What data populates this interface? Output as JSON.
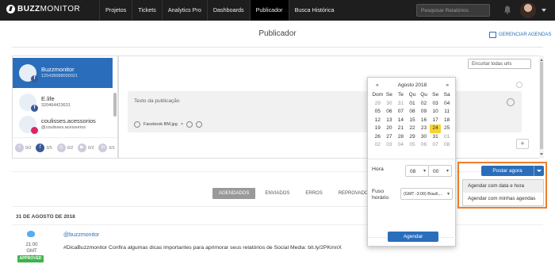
{
  "brand": {
    "name_bold": "BUZZ",
    "name_light": "MONITOR"
  },
  "nav": [
    {
      "label": "Projetos"
    },
    {
      "label": "Tickets"
    },
    {
      "label": "Analytics Pro"
    },
    {
      "label": "Dashboards"
    },
    {
      "label": "Publicador",
      "active": true
    },
    {
      "label": "Busca Histórica"
    }
  ],
  "search": {
    "placeholder": "Pesquisar Relatórios"
  },
  "page": {
    "title": "Publicador",
    "manage_label": "GERENCIAR AGENDAS"
  },
  "accounts": [
    {
      "name": "Buzzmonitor",
      "id": "125438688000021",
      "selected": true
    },
    {
      "name": "E.life",
      "id": "320464423631"
    },
    {
      "name": "coulisses.acessorios",
      "id": "@coulisses.acessorios"
    }
  ],
  "networks": [
    {
      "icon": "twitter-icon",
      "count": "0/2"
    },
    {
      "icon": "facebook-icon",
      "count": "3/5",
      "active": true
    },
    {
      "icon": "instagram-icon",
      "count": "0/2"
    },
    {
      "icon": "youtube-icon",
      "count": "0/2"
    },
    {
      "icon": "linkedin-icon",
      "count": "0/1"
    }
  ],
  "editor": {
    "shorten_label": "Encurtar todas urls",
    "placeholder": "Texto da publicação",
    "attachment": "Facebook BM.jpg",
    "remove": "×",
    "add": "+"
  },
  "calendar": {
    "prev": "«",
    "next": "»",
    "month": "Agosto 2018",
    "weekdays": [
      "Dom",
      "Se",
      "Te",
      "Qu",
      "Qu",
      "Se",
      "Sa"
    ],
    "weeks": [
      [
        "29",
        "30",
        "31",
        "01",
        "02",
        "03",
        "04"
      ],
      [
        "05",
        "06",
        "07",
        "08",
        "09",
        "10",
        "11"
      ],
      [
        "12",
        "13",
        "14",
        "15",
        "16",
        "17",
        "18"
      ],
      [
        "19",
        "20",
        "21",
        "22",
        "23",
        "24",
        "25"
      ],
      [
        "26",
        "27",
        "28",
        "29",
        "30",
        "31",
        "01"
      ],
      [
        "02",
        "03",
        "04",
        "05",
        "06",
        "07",
        "08"
      ]
    ],
    "today": "24",
    "hour_label": "Hora",
    "hour": "08",
    "minute": "00",
    "tz_label": "Fuso horário",
    "tz_value": "(GMT -3:00) Brazil,...",
    "schedule_label": "Agendar"
  },
  "post": {
    "button": "Postar agora",
    "menu": [
      "Agendar com data e hora",
      "Agendar com minhas agendas"
    ]
  },
  "tabs": [
    {
      "label": "AGENDADOS",
      "active": true
    },
    {
      "label": "ENVIADOS"
    },
    {
      "label": "ERROS"
    },
    {
      "label": "REPROVADOS"
    }
  ],
  "feed": {
    "date": "31 DE AGOSTO DE 2018",
    "time": "21:00",
    "tz": "GMT -3.0",
    "status": "APPROVED",
    "handle": "@buzzmonitor",
    "text": "#DicaBuzzmonitor Confira algumas dicas importantes para aprimorar seus relatórios de Social Media: bit.ly/2PKmnX"
  },
  "colors": {
    "accent": "#2a6ebb",
    "highlight": "#ee7d29",
    "approved": "#3bb54a",
    "today": "#f7d332"
  }
}
